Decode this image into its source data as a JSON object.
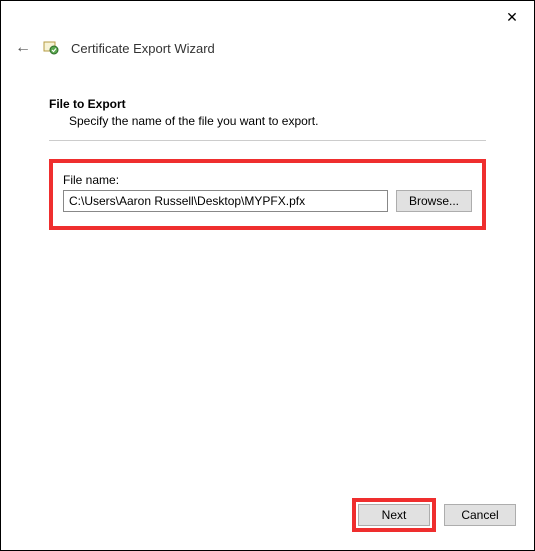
{
  "titlebar": {
    "close_glyph": "✕"
  },
  "header": {
    "back_glyph": "←",
    "title": "Certificate Export Wizard"
  },
  "section": {
    "title": "File to Export",
    "subtitle": "Specify the name of the file you want to export."
  },
  "file": {
    "label": "File name:",
    "value": "C:\\Users\\Aaron Russell\\Desktop\\MYPFX.pfx",
    "browse_label": "Browse..."
  },
  "footer": {
    "next_label": "Next",
    "cancel_label": "Cancel"
  },
  "icons": {
    "wizard": "certificate-icon"
  }
}
